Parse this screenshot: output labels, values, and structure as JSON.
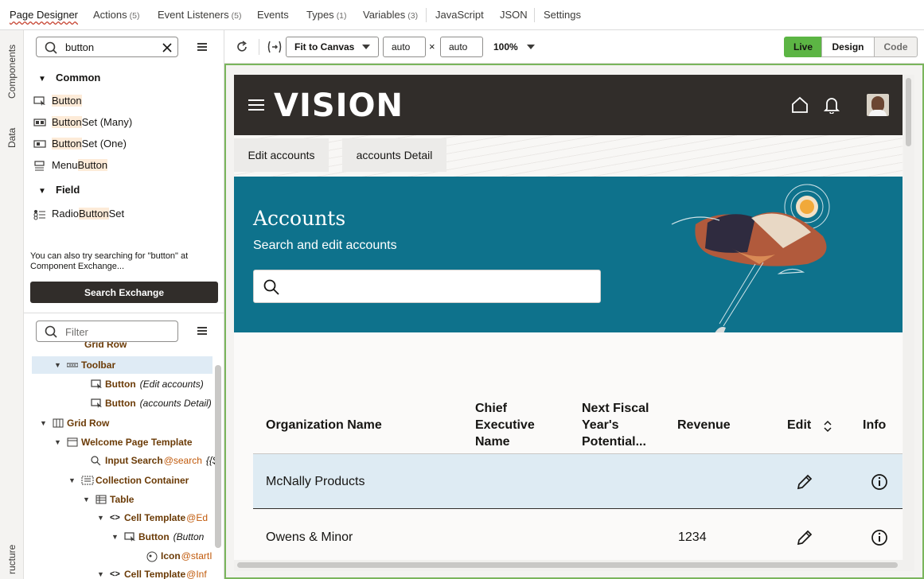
{
  "top_tabs": [
    {
      "label": "Page Designer",
      "count": ""
    },
    {
      "label": "Actions",
      "count": "(5)"
    },
    {
      "label": "Event Listeners",
      "count": "(5)"
    },
    {
      "label": "Events",
      "count": ""
    },
    {
      "label": "Types",
      "count": "(1)"
    },
    {
      "label": "Variables",
      "count": "(3)"
    },
    {
      "label": "JavaScript",
      "count": ""
    },
    {
      "label": "JSON",
      "count": ""
    },
    {
      "label": "Settings",
      "count": ""
    }
  ],
  "side_rail": [
    "Components",
    "Data",
    "ructure"
  ],
  "components": {
    "search_value": "button",
    "groups": [
      {
        "label": "Common",
        "items": [
          {
            "pre": "",
            "hit": "Button",
            "post": "",
            "icon": "button-icon"
          },
          {
            "pre": "",
            "hit": "Button",
            "post": " Set (Many)",
            "icon": "button-set-icon"
          },
          {
            "pre": "",
            "hit": "Button",
            "post": " Set (One)",
            "icon": "button-set-one-icon"
          },
          {
            "pre": "Menu ",
            "hit": "Button",
            "post": "",
            "icon": "menu-button-icon"
          }
        ]
      },
      {
        "label": "Field",
        "items": [
          {
            "pre": "Radio ",
            "hit": "Button",
            "post": " Set",
            "icon": "radio-set-icon"
          }
        ]
      }
    ],
    "hint": "You can also try searching for \"button\" at Component Exchange...",
    "exchange_button": "Search Exchange"
  },
  "structure": {
    "filter_placeholder": "Filter",
    "nodes": [
      {
        "label": "Grid Row",
        "desc": "",
        "at": ""
      },
      {
        "label": "Toolbar",
        "desc": "",
        "at": ""
      },
      {
        "label": "Button",
        "desc": "(Edit accounts)",
        "at": ""
      },
      {
        "label": "Button",
        "desc": "(accounts Detail)",
        "at": ""
      },
      {
        "label": "Grid Row",
        "desc": "",
        "at": ""
      },
      {
        "label": "Welcome Page Template",
        "desc": "",
        "at": ""
      },
      {
        "label": "Input Search",
        "desc": "",
        "at": "@search",
        "extra": "{{$"
      },
      {
        "label": "Collection Container",
        "desc": "",
        "at": ""
      },
      {
        "label": "Table",
        "desc": "",
        "at": ""
      },
      {
        "label": "Cell Template",
        "desc": "",
        "at": "@Ed"
      },
      {
        "label": "Button",
        "desc": "(Button",
        "at": ""
      },
      {
        "label": "Icon",
        "desc": "",
        "at": "@startI"
      },
      {
        "label": "Cell Template",
        "desc": "",
        "at": "@Inf"
      }
    ]
  },
  "toolbar": {
    "fit": "Fit to Canvas",
    "width": "auto",
    "times": "×",
    "height": "auto",
    "zoom": "100%",
    "modes": [
      "Live",
      "Design",
      "Code"
    ],
    "active_mode": "Live"
  },
  "preview": {
    "brand": "VISION",
    "nav_buttons": [
      "Edit accounts",
      "accounts Detail"
    ],
    "hero_title": "Accounts",
    "hero_subtitle": "Search and edit accounts",
    "columns": [
      "Organization Name",
      "Chief\nExecutive\nName",
      "Next Fiscal\nYear's\nPotential...",
      "Revenue",
      "Edit",
      "Info"
    ],
    "rows": [
      {
        "org": "McNally Products",
        "ceo": "",
        "next": "",
        "revenue": ""
      },
      {
        "org": "Owens & Minor",
        "ceo": "",
        "next": "",
        "revenue": "1234"
      }
    ],
    "colors": {
      "header": "#312d2a",
      "hero": "#0e728c",
      "selected_row": "#deebf3",
      "live": "#5cb544"
    }
  }
}
